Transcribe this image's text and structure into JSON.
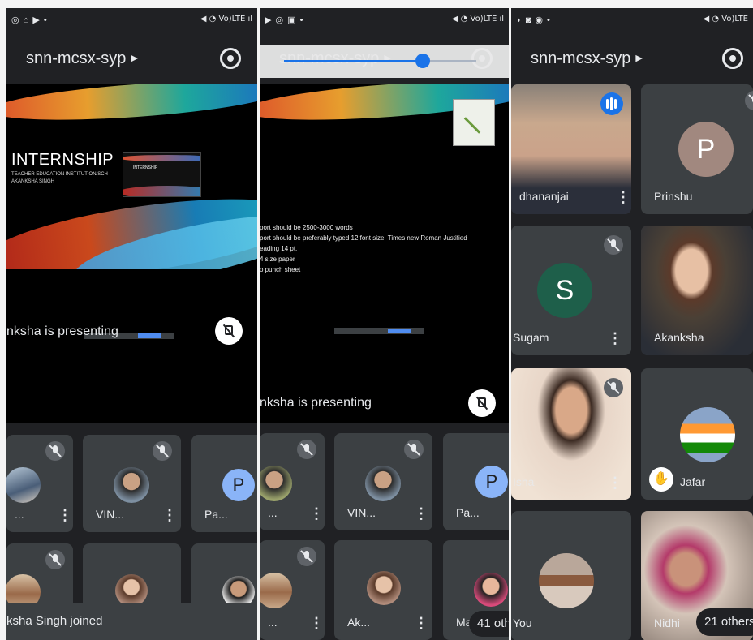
{
  "panel1": {
    "status_left": "◎ ⌂ ▶ •",
    "status_right": "◀ ◔ Vo)LTE ıl",
    "meet_code": "snn-mcsx-syp",
    "slide_title": "INTERNSHIP",
    "slide_line1": "TEACHER EDUCATION INSTITUTION/SCH",
    "slide_line2": "AKANKSHA SINGH",
    "thumb_title": "INTERNSHIP",
    "presenting": "nksha is presenting",
    "tiles": [
      {
        "name": "..."
      },
      {
        "name": "VIN..."
      },
      {
        "name": "Pa...",
        "letter": "P"
      }
    ],
    "toast": "ksha Singh joined"
  },
  "panel2": {
    "status_left": "▶ ◎ ▣ •",
    "status_right": "◀ ◔ Vo)LTE ıl",
    "meet_code": "snn-mcsx-syp",
    "seek_progress": 0.72,
    "bullets": [
      "port should be 2500-3000 words",
      "port should be preferably typed 12 font size, Times new Roman Justified",
      "eading 14 pt.",
      "4 size paper",
      "o punch sheet"
    ],
    "presenting": "nksha is presenting",
    "tiles": [
      {
        "name": "..."
      },
      {
        "name": "VIN..."
      },
      {
        "name": "Pa...",
        "letter": "P"
      },
      {
        "name": "..."
      },
      {
        "name": "Ak..."
      },
      {
        "name": "Ma"
      }
    ],
    "others": "41 oth"
  },
  "panel3": {
    "status_left": "◗ ◙ ◉ •",
    "status_right": "◀ ◔ Vo)LTE",
    "meet_code": "snn-mcsx-syp",
    "tiles": [
      {
        "name": "dhananjai"
      },
      {
        "name": "Prinshu",
        "letter": "P"
      },
      {
        "name": "Sugam",
        "letter": "S"
      },
      {
        "name": "Akanksha"
      },
      {
        "name": "Isha"
      },
      {
        "name": "Jafar"
      },
      {
        "name": "You"
      },
      {
        "name": "Nidhi"
      }
    ],
    "others": "21 others"
  },
  "colors": {
    "background": "#202124",
    "tile": "#3c4043",
    "accent": "#1a73e8",
    "avatar_prinshu": "#a1887f",
    "avatar_sugam": "#1e5f4a",
    "avatar_pa": "#8ab4f8"
  }
}
